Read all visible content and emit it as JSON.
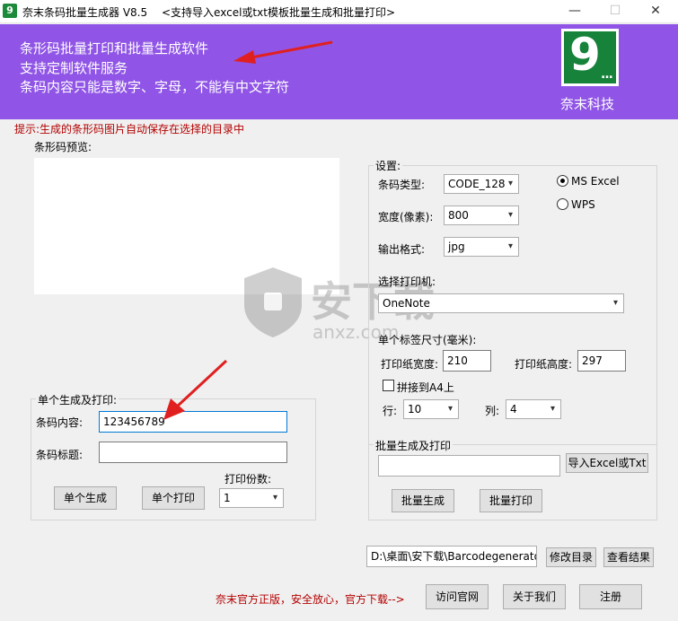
{
  "window": {
    "icon_glyph": "9",
    "title": "奈末条码批量生成器 V8.5",
    "subtitle": "<支持导入excel或txt模板批量生成和批量打印>",
    "minimize": "—",
    "maximize": "☐",
    "close": "✕"
  },
  "banner": {
    "lines": [
      "条形码批量打印和批量生成软件",
      "支持定制软件服务",
      "条码内容只能是数字、字母，不能有中文字符"
    ],
    "logo_glyph": "9",
    "logo_dots": "...",
    "logo_text": "奈末科技",
    "bg_color": "#9055e6"
  },
  "hint": "提示:生成的条形码图片自动保存在选择的目录中",
  "preview": {
    "label": "条形码预览:"
  },
  "single": {
    "title": "单个生成及打印:",
    "content_label": "条码内容:",
    "content_value": "123456789",
    "caption_label": "条码标题:",
    "caption_value": "",
    "copies_label": "打印份数:",
    "copies_value": "1",
    "generate_button": "单个生成",
    "print_button": "单个打印"
  },
  "settings": {
    "title": "设置:",
    "type_label": "条码类型:",
    "type_value": "CODE_128",
    "width_label": "宽度(像素):",
    "width_value": "800",
    "format_label": "输出格式:",
    "format_value": "jpg",
    "radio_ms": "MS  Excel",
    "radio_wps": "WPS",
    "printer_label": "选择打印机:",
    "printer_value": "OneNote",
    "label_size_label": "单个标签尺寸(毫米):",
    "paper_width_label": "打印纸宽度:",
    "paper_width_value": "210",
    "paper_height_label": "打印纸高度:",
    "paper_height_value": "297",
    "a4_label": "拼接到A4上",
    "rows_label": "行:",
    "rows_value": "10",
    "cols_label": "列:",
    "cols_value": "4"
  },
  "batch": {
    "title": "批量生成及打印",
    "file_value": "",
    "import_button": "导入Excel或Txt",
    "generate_button": "批量生成",
    "print_button": "批量打印"
  },
  "directory": {
    "path_value": "D:\\桌面\\安下载\\Barcodegenerato",
    "change_button": "修改目录",
    "view_button": "查看结果"
  },
  "footer": {
    "notice": "奈末官方正版，安全放心，官方下载-->",
    "visit_button": "访问官网",
    "about_button": "关于我们",
    "register_button": "注册"
  },
  "watermark": {
    "brand": "安下载",
    "domain": "anxz.com"
  }
}
